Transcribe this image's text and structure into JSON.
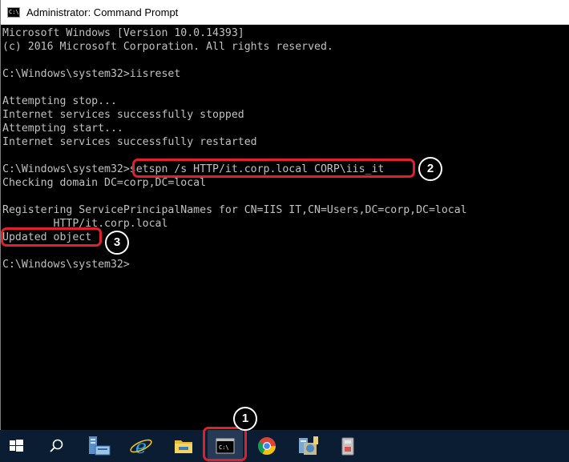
{
  "window": {
    "title": "Administrator: Command Prompt",
    "icon_label": "C:\\."
  },
  "console": {
    "lines": [
      "Microsoft Windows [Version 10.0.14393]",
      "(c) 2016 Microsoft Corporation. All rights reserved.",
      "",
      "C:\\Windows\\system32>iisreset",
      "",
      "Attempting stop...",
      "Internet services successfully stopped",
      "Attempting start...",
      "Internet services successfully restarted",
      "",
      "C:\\Windows\\system32>setspn /s HTTP/it.corp.local CORP\\iis_it",
      "Checking domain DC=corp,DC=local",
      "",
      "Registering ServicePrincipalNames for CN=IIS IT,CN=Users,DC=corp,DC=local",
      "        HTTP/it.corp.local",
      "Updated object",
      "",
      "C:\\Windows\\system32>"
    ]
  },
  "callouts": {
    "step1": "1",
    "step2": "2",
    "step3": "3",
    "highlight_color": "#e0202a"
  },
  "taskbar": {
    "items": [
      {
        "icon": "windows-start-icon"
      },
      {
        "icon": "search-icon"
      },
      {
        "icon": "server-manager-icon"
      },
      {
        "icon": "internet-explorer-icon"
      },
      {
        "icon": "file-explorer-icon"
      },
      {
        "icon": "command-prompt-icon",
        "active": true
      },
      {
        "icon": "chrome-icon"
      },
      {
        "icon": "iis-manager-icon"
      },
      {
        "icon": "application-icon"
      }
    ]
  }
}
